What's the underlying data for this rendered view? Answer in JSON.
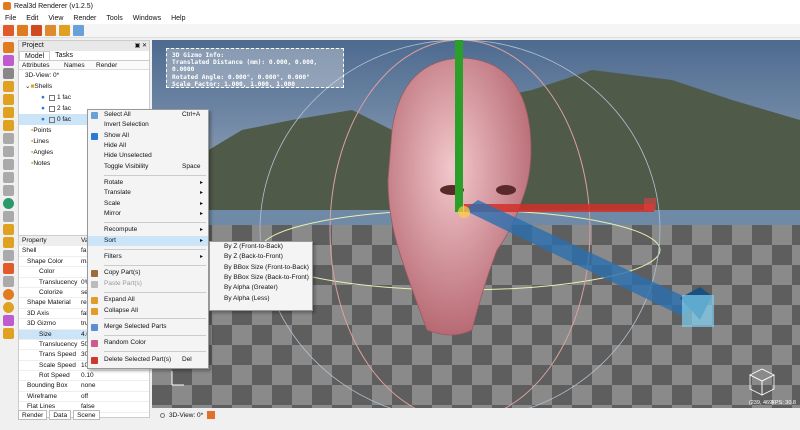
{
  "app": {
    "title": "Real3d Renderer (v1.2.5)"
  },
  "menu": [
    "File",
    "Edit",
    "View",
    "Render",
    "Tools",
    "Windows",
    "Help"
  ],
  "project": {
    "title": "Project",
    "tabs": [
      "Model",
      "Tasks"
    ],
    "columns": [
      "Attributes",
      "Names",
      "Render"
    ],
    "tree": [
      {
        "label": "3D-View: 0*"
      },
      {
        "label": "Shells"
      },
      {
        "label": "1 fac"
      },
      {
        "label": "2 fac"
      },
      {
        "label": "0 fac"
      },
      {
        "label": "Points"
      },
      {
        "label": "Lines"
      },
      {
        "label": "Angles"
      },
      {
        "label": "Notes"
      }
    ]
  },
  "property": {
    "columns": [
      "Property",
      "Va"
    ],
    "rows": [
      {
        "k": "Shell",
        "v": "fa"
      },
      {
        "k": "Shape Color",
        "v": "ma"
      },
      {
        "k": "Color",
        "v": ""
      },
      {
        "k": "Translucency",
        "v": "0%"
      },
      {
        "k": "Colorize",
        "v": "sel"
      },
      {
        "k": "Shape Material",
        "v": "rea"
      },
      {
        "k": "3D Axis",
        "v": "fals"
      },
      {
        "k": "3D Gizmo",
        "v": "tru"
      },
      {
        "k": "Size",
        "v": "4.0"
      },
      {
        "k": "Translucency",
        "v": "50"
      },
      {
        "k": "Trans Speed",
        "v": "30"
      },
      {
        "k": "Scale Speed",
        "v": "100"
      },
      {
        "k": "Rot Speed",
        "v": "0.10"
      },
      {
        "k": "Bounding Box",
        "v": "none"
      },
      {
        "k": "Wireframe",
        "v": "off"
      },
      {
        "k": "Flat Lines",
        "v": "false"
      }
    ],
    "bottom_tabs": [
      "Render",
      "Data",
      "Scene"
    ]
  },
  "gizmo_info": [
    "3D Gizmo Info:",
    "Translated Distance (mm): 0.000, 0.000, 0.0000",
    "Rotated Angle: 0.000°, 0.000°, 0.000°",
    "Scale Factor: 1.000, 1.000, 1.000"
  ],
  "viewport": {
    "fps": "FPS: 30.8",
    "coords": "(239, 469)"
  },
  "status": {
    "tab": "3D-View: 0*"
  },
  "context_menu": [
    {
      "label": "Select All",
      "shortcut": "Ctrl+A",
      "icon": "#6aa0d8"
    },
    {
      "label": "Invert Selection",
      "shortcut": "",
      "icon": ""
    },
    {
      "label": "Show All",
      "shortcut": "",
      "icon": "#2a7bd6"
    },
    {
      "label": "Hide All",
      "shortcut": "",
      "icon": ""
    },
    {
      "label": "Hide Unselected",
      "shortcut": "",
      "icon": ""
    },
    {
      "label": "Toggle Visibility",
      "shortcut": "Space",
      "icon": ""
    },
    {
      "sep": true
    },
    {
      "label": "Rotate",
      "arrow": "▸",
      "icon": ""
    },
    {
      "label": "Translate",
      "arrow": "▸",
      "icon": ""
    },
    {
      "label": "Scale",
      "arrow": "▸",
      "icon": ""
    },
    {
      "label": "Mirror",
      "arrow": "▸",
      "icon": ""
    },
    {
      "sep": true
    },
    {
      "label": "Recompute",
      "arrow": "▸",
      "icon": ""
    },
    {
      "label": "Sort",
      "arrow": "▸",
      "icon": "",
      "hl": true
    },
    {
      "sep": true
    },
    {
      "label": "Filters",
      "arrow": "▸",
      "icon": ""
    },
    {
      "sep": true
    },
    {
      "label": "Copy Part(s)",
      "shortcut": "",
      "icon": "#9b6b3e"
    },
    {
      "label": "Paste Part(s)",
      "shortcut": "",
      "icon": "#bbb",
      "dis": true
    },
    {
      "sep": true
    },
    {
      "label": "Expand All",
      "shortcut": "",
      "icon": "#e39b2a"
    },
    {
      "label": "Collapse All",
      "shortcut": "",
      "icon": "#e39b2a"
    },
    {
      "sep": true
    },
    {
      "label": "Merge Selected Parts",
      "shortcut": "",
      "icon": "#5a8ed0"
    },
    {
      "sep": true
    },
    {
      "label": "Random Color",
      "shortcut": "",
      "icon": "#d05a8e"
    },
    {
      "sep": true
    },
    {
      "label": "Delete Selected Part(s)",
      "shortcut": "Del",
      "icon": "#d0392a"
    }
  ],
  "sort_menu": [
    "By Z (Front-to-Back)",
    "By Z (Back-to-Front)",
    "By BBox Size (Front-to-Back)",
    "By BBox Size (Back-to-Front)",
    "By Alpha (Greater)",
    "By Alpha (Less)"
  ],
  "colors": {
    "accent": "#2a7bd6",
    "highlight": "#cce4f7",
    "axis_x": "#d0302a",
    "axis_y": "#2aa02a",
    "axis_z": "#2a6fb0"
  }
}
